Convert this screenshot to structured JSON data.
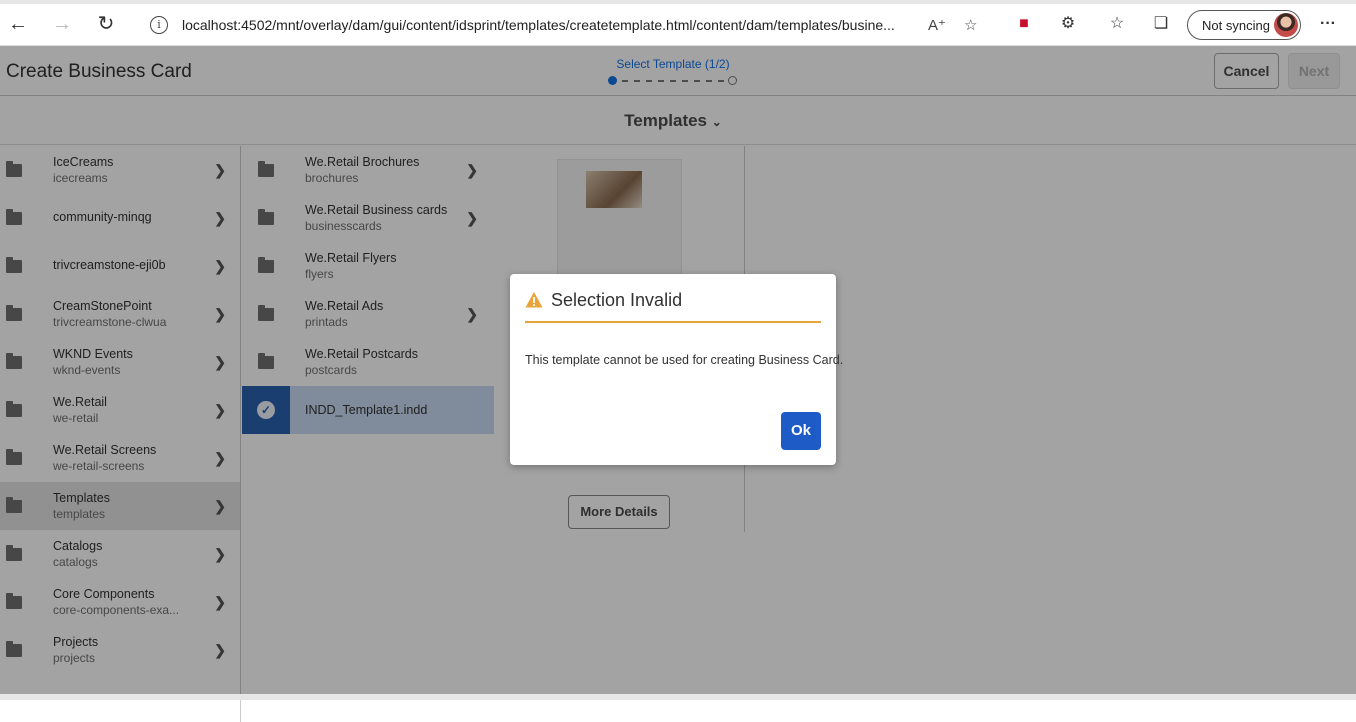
{
  "browser": {
    "url": "localhost:4502/mnt/overlay/dam/gui/content/idsprint/templates/createtemplate.html/content/dam/templates/busine...",
    "profile_label": "Not syncing"
  },
  "header": {
    "title": "Create Business Card",
    "wizard_step": "Select Template (1/2)",
    "cancel_label": "Cancel",
    "next_label": "Next"
  },
  "subheader": {
    "title": "Templates"
  },
  "column1": [
    {
      "title": "IceCreams",
      "sub": "icecreams"
    },
    {
      "title": "community-minqg",
      "sub": ""
    },
    {
      "title": "trivcreamstone-eji0b",
      "sub": ""
    },
    {
      "title": "CreamStonePoint",
      "sub": "trivcreamstone-clwua"
    },
    {
      "title": "WKND Events",
      "sub": "wknd-events"
    },
    {
      "title": "We.Retail",
      "sub": "we-retail"
    },
    {
      "title": "We.Retail Screens",
      "sub": "we-retail-screens"
    },
    {
      "title": "Templates",
      "sub": "templates"
    },
    {
      "title": "Catalogs",
      "sub": "catalogs"
    },
    {
      "title": "Core Components",
      "sub": "core-components-exa..."
    },
    {
      "title": "Projects",
      "sub": "projects"
    }
  ],
  "column2": [
    {
      "title": "We.Retail Brochures",
      "sub": "brochures"
    },
    {
      "title": "We.Retail Business cards",
      "sub": "businesscards"
    },
    {
      "title": "We.Retail Flyers",
      "sub": "flyers"
    },
    {
      "title": "We.Retail Ads",
      "sub": "printads"
    },
    {
      "title": "We.Retail Postcards",
      "sub": "postcards"
    }
  ],
  "selected_file": {
    "name": "INDD_Template1.indd"
  },
  "preview": {
    "more_details_label": "More Details"
  },
  "dialog": {
    "title": "Selection Invalid",
    "message": "This template cannot be used for creating Business Card.",
    "ok_label": "Ok"
  },
  "colors": {
    "accent": "#1473e6",
    "ok_button": "#1e5bc6",
    "warning": "#e8a33a"
  }
}
